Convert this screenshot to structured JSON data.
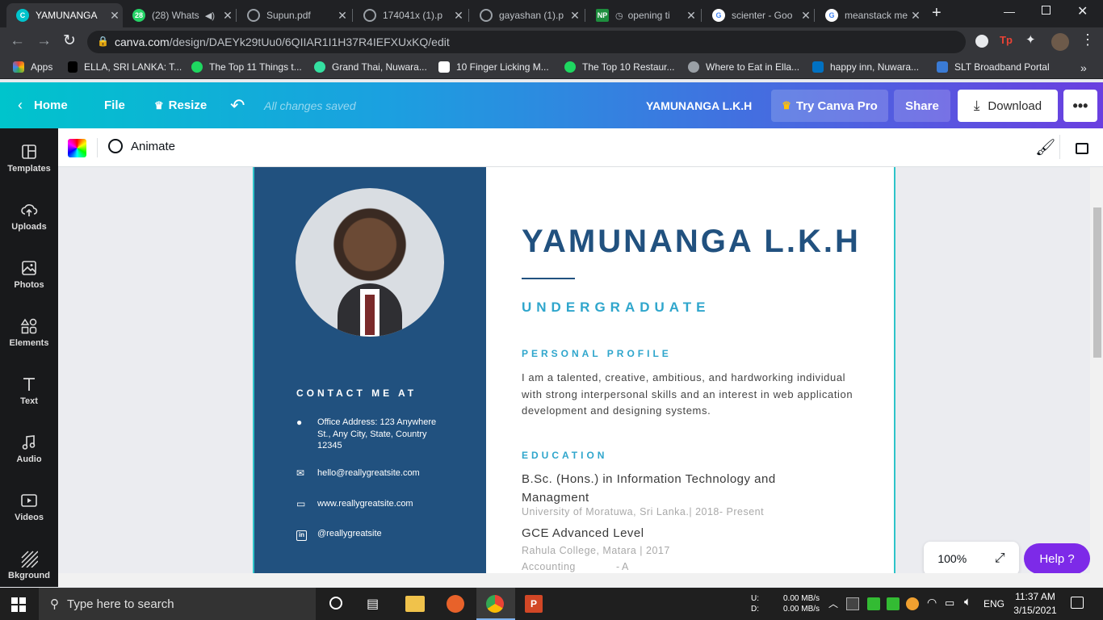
{
  "browser": {
    "tabs": [
      {
        "title": "YAMUNANGA",
        "active": true,
        "icon": "canva-icon",
        "color": "#00c4cc"
      },
      {
        "title": "(28) Whats",
        "active": false,
        "icon": "whatsapp-icon",
        "color": "#25d366"
      },
      {
        "title": "Supun.pdf",
        "active": false,
        "icon": "globe-icon",
        "color": "#5f6368"
      },
      {
        "title": "174041x (1).p",
        "active": false,
        "icon": "globe-icon",
        "color": "#5f6368"
      },
      {
        "title": "gayashan (1).p",
        "active": false,
        "icon": "globe-icon",
        "color": "#5f6368"
      },
      {
        "title": "opening ti",
        "active": false,
        "icon": "np-icon",
        "color": "#1e8e3e"
      },
      {
        "title": "scienter - Goo",
        "active": false,
        "icon": "google-icon",
        "color": "#4285f4"
      },
      {
        "title": "meanstack me",
        "active": false,
        "icon": "google-icon",
        "color": "#4285f4"
      }
    ],
    "address": {
      "host": "canva.com",
      "path": "/design/DAEYk29tUu0/6QIIAR1I1H37R4IEFXUxKQ/edit"
    },
    "bookmarks": [
      {
        "label": "Apps",
        "color": "#ea4335"
      },
      {
        "label": "ELLA, SRI LANKA: T...",
        "color": "#000000"
      },
      {
        "label": "The Top 11 Things t...",
        "color": "#1ed760"
      },
      {
        "label": "Grand Thai, Nuwara...",
        "color": "#34e0a1"
      },
      {
        "label": "10 Finger Licking M...",
        "color": "#ffffff"
      },
      {
        "label": "The Top 10 Restaur...",
        "color": "#1ed760"
      },
      {
        "label": "Where to Eat in Ella...",
        "color": "#9aa0a6"
      },
      {
        "label": "happy inn, Nuwara...",
        "color": "#0071c2"
      },
      {
        "label": "SLT Broadband Portal",
        "color": "#3a7bd5"
      }
    ]
  },
  "canva": {
    "header": {
      "home": "Home",
      "file": "File",
      "resize": "Resize",
      "saved": "All changes saved",
      "doc_title": "YAMUNANGA L.K.H",
      "try_pro": "Try Canva Pro",
      "share": "Share",
      "download": "Download"
    },
    "sidebar": [
      {
        "label": "Templates",
        "icon": "templates-icon"
      },
      {
        "label": "Uploads",
        "icon": "upload-cloud-icon"
      },
      {
        "label": "Photos",
        "icon": "photo-icon"
      },
      {
        "label": "Elements",
        "icon": "shapes-icon"
      },
      {
        "label": "Text",
        "icon": "text-icon"
      },
      {
        "label": "Audio",
        "icon": "music-note-icon"
      },
      {
        "label": "Videos",
        "icon": "video-icon"
      },
      {
        "label": "Bkground",
        "icon": "hatch-icon"
      }
    ],
    "editor_toolbar": {
      "animate": "Animate"
    },
    "zoom": "100%",
    "help": "Help ?"
  },
  "resume": {
    "name": "YAMUNANGA L.K.H",
    "subtitle": "UNDERGRADUATE",
    "contact_heading": "CONTACT ME AT",
    "contact": [
      {
        "icon": "location-pin-icon",
        "text": "Office Address: 123 Anywhere St., Any City, State, Country 12345"
      },
      {
        "icon": "mail-icon",
        "text": "hello@reallygreatsite.com"
      },
      {
        "icon": "laptop-icon",
        "text": "www.reallygreatsite.com"
      },
      {
        "icon": "linkedin-icon",
        "text": "@reallygreatsite"
      }
    ],
    "profile_heading": "PERSONAL PROFILE",
    "profile_text": "I am a talented, creative, ambitious, and hardworking individual with strong interpersonal skills and an interest in web  application development and designing systems.",
    "education_heading": "EDUCATION",
    "education": [
      {
        "degree": "B.Sc. (Hons.) in Information Technology and Managment",
        "detail": "University of Moratuwa, Sri Lanka.| 2018- Present"
      },
      {
        "degree": "GCE Advanced Level",
        "detail": "Rahula College, Matara | 2017"
      }
    ],
    "subject_line": {
      "subject": "Accounting",
      "grade": "- A"
    }
  },
  "taskbar": {
    "search_placeholder": "Type here to search",
    "net_up_label": "U:",
    "net_down_label": "D:",
    "net_up": "0.00 MB/s",
    "net_down": "0.00 MB/s",
    "lang": "ENG",
    "time": "11:37 AM",
    "date": "3/15/2021"
  }
}
